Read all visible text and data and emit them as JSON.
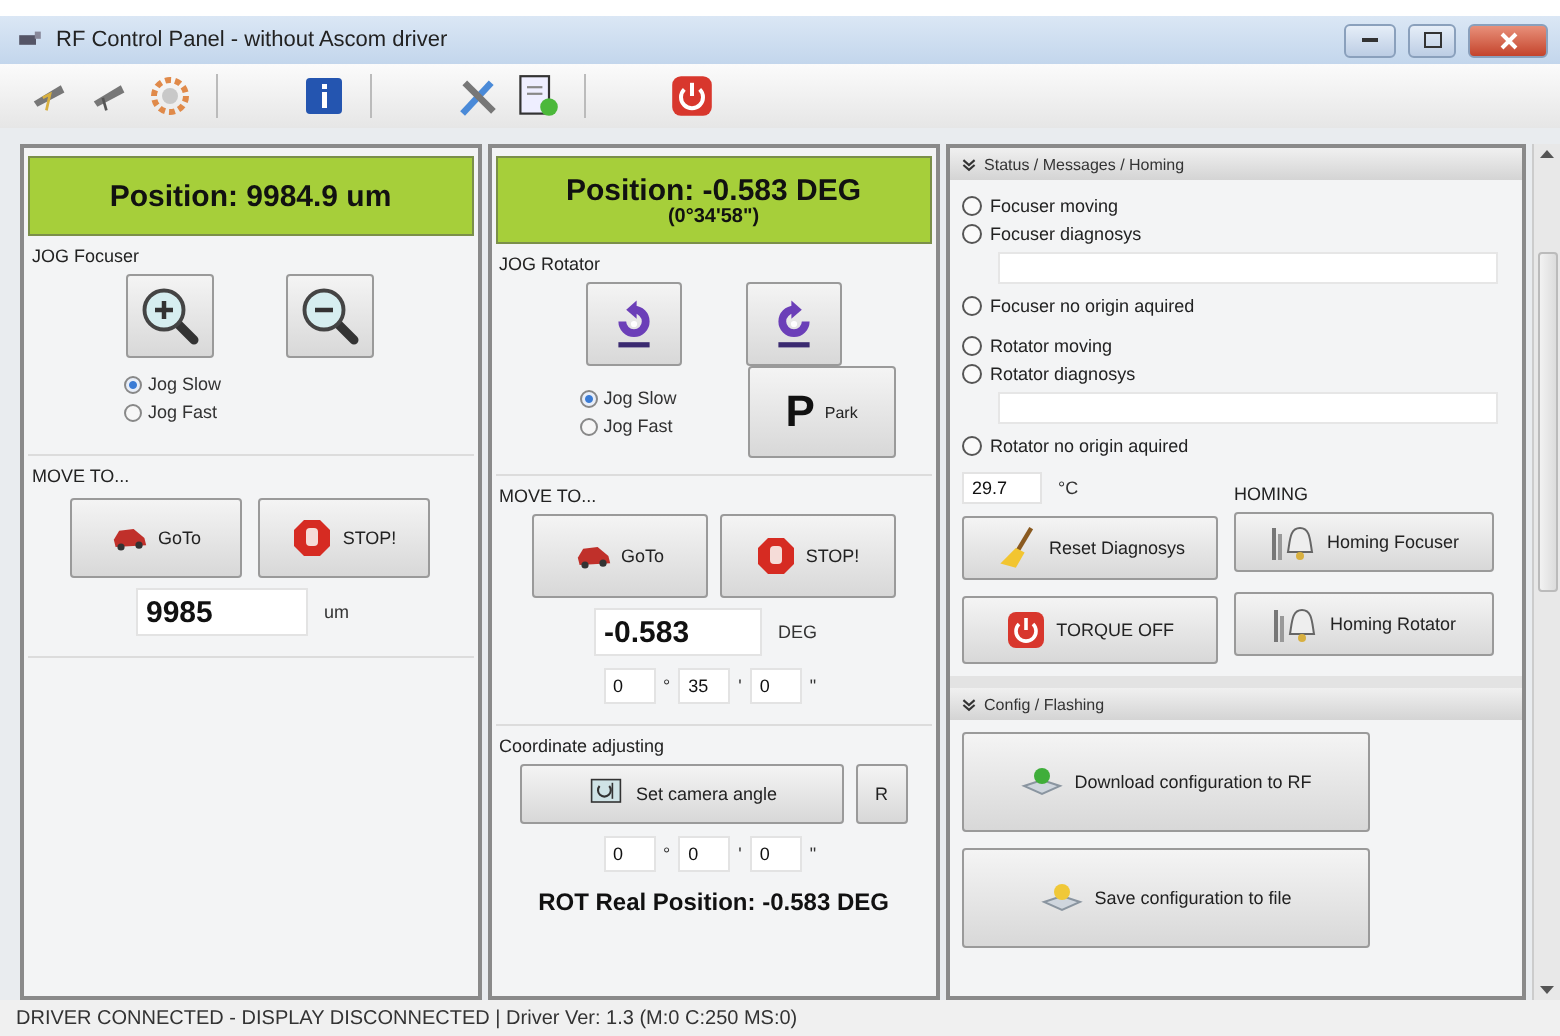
{
  "window": {
    "title": "RF Control Panel - without Ascom driver"
  },
  "focuser": {
    "position": "Position: 9984.9 um",
    "jog_label": "JOG Focuser",
    "jog_modes": [
      {
        "label": "Jog Slow",
        "selected": true
      },
      {
        "label": "Jog Fast",
        "selected": false
      }
    ],
    "move_label": "MOVE TO...",
    "goto": "GoTo",
    "stop": "STOP!",
    "target": "9985",
    "unit": "um"
  },
  "rotator": {
    "position": "Position: -0.583 DEG",
    "position_dms": "(0°34'58\")",
    "jog_label": "JOG Rotator",
    "jog_modes": [
      {
        "label": "Jog Slow",
        "selected": true
      },
      {
        "label": "Jog Fast",
        "selected": false
      }
    ],
    "park_letter": "P",
    "park": "Park",
    "move_label": "MOVE TO...",
    "goto": "GoTo",
    "stop": "STOP!",
    "target": "-0.583",
    "unit": "DEG",
    "dms_fields": [
      {
        "value": "0",
        "unit": "°"
      },
      {
        "value": "35",
        "unit": "'"
      },
      {
        "value": "0",
        "unit": "\""
      }
    ],
    "adjust_label": "Coordinate adjusting",
    "set_angle": "Set camera angle",
    "reset": "R",
    "adjust_fields": [
      {
        "value": "0",
        "unit": "°"
      },
      {
        "value": "0",
        "unit": "'"
      },
      {
        "value": "0",
        "unit": "\""
      }
    ],
    "real_position": "ROT Real Position: -0.583 DEG"
  },
  "status": {
    "title": "Status / Messages / Homing",
    "indicators": [
      {
        "kind": "indicator",
        "label": "Focuser moving",
        "on": false
      },
      {
        "kind": "indicator",
        "label": "Focuser diagnosys",
        "on": false
      },
      {
        "kind": "message_field"
      },
      {
        "kind": "indicator",
        "label": "Focuser no origin aquired",
        "on": false
      },
      {
        "kind": "gap"
      },
      {
        "kind": "indicator",
        "label": "Rotator moving",
        "on": false
      },
      {
        "kind": "indicator",
        "label": "Rotator diagnosys",
        "on": false
      },
      {
        "kind": "message_field"
      },
      {
        "kind": "indicator",
        "label": "Rotator no origin aquired",
        "on": false
      }
    ],
    "temperature": "29.7",
    "temp_unit": "°C",
    "homing_label": "HOMING",
    "reset": "Reset Diagnosys",
    "torque": "TORQUE OFF",
    "homing_focuser": "Homing Focuser",
    "homing_rotator": "Homing Rotator"
  },
  "config": {
    "title": "Config / Flashing",
    "download": "Download configuration to RF",
    "save": "Save configuration to file"
  },
  "status_bar": "DRIVER CONNECTED - DISPLAY DISCONNECTED | Driver Ver: 1.3 (M:0 C:250 MS:0)"
}
